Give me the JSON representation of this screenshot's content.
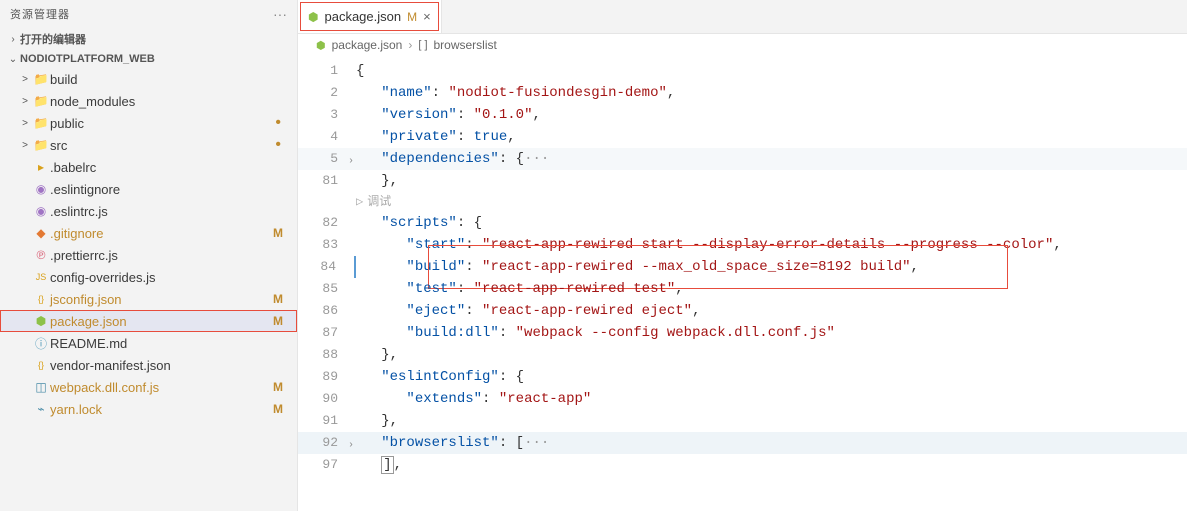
{
  "sidebar": {
    "title": "资源管理器",
    "open_editors": "打开的编辑器",
    "project": "NODIOTPLATFORM_WEB",
    "tree": [
      {
        "type": "folder",
        "label": "build",
        "icon": "folder",
        "indent": 1,
        "chev": ">"
      },
      {
        "type": "folder",
        "label": "node_modules",
        "icon": "folder-green",
        "indent": 1,
        "chev": ">"
      },
      {
        "type": "folder",
        "label": "public",
        "icon": "folder",
        "indent": 1,
        "chev": ">",
        "dot": true
      },
      {
        "type": "folder",
        "label": "src",
        "icon": "folder",
        "indent": 1,
        "chev": ">",
        "dot": true
      },
      {
        "type": "file",
        "label": ".babelrc",
        "icon": "babel",
        "indent": 1,
        "color": "file-yellow"
      },
      {
        "type": "file",
        "label": ".eslintignore",
        "icon": "eslint",
        "indent": 1,
        "color": "file-purple"
      },
      {
        "type": "file",
        "label": ".eslintrc.js",
        "icon": "eslint",
        "indent": 1,
        "color": "file-purple"
      },
      {
        "type": "file",
        "label": ".gitignore",
        "icon": "git",
        "indent": 1,
        "color": "file-orange",
        "badge": "M"
      },
      {
        "type": "file",
        "label": ".prettierrc.js",
        "icon": "prettier",
        "indent": 1,
        "color": "file-pink"
      },
      {
        "type": "file",
        "label": "config-overrides.js",
        "icon": "js",
        "indent": 1,
        "color": "file-yellow"
      },
      {
        "type": "file",
        "label": "jsconfig.json",
        "icon": "json",
        "indent": 1,
        "color": "file-yellow",
        "badge": "M"
      },
      {
        "type": "file",
        "label": "package.json",
        "icon": "npm",
        "indent": 1,
        "color": "file-green",
        "badge": "M",
        "selected": true,
        "highlighted": true
      },
      {
        "type": "file",
        "label": "README.md",
        "icon": "info",
        "indent": 1,
        "color": "file-teal"
      },
      {
        "type": "file",
        "label": "vendor-manifest.json",
        "icon": "json",
        "indent": 1,
        "color": "file-yellow"
      },
      {
        "type": "file",
        "label": "webpack.dll.conf.js",
        "icon": "webpack",
        "indent": 1,
        "color": "file-blue",
        "badge": "M"
      },
      {
        "type": "file",
        "label": "yarn.lock",
        "icon": "yarn",
        "indent": 1,
        "color": "file-blue",
        "badge": "M"
      }
    ]
  },
  "tab": {
    "title": "package.json",
    "mod": "M",
    "highlighted": true
  },
  "breadcrumbs": {
    "file": "package.json",
    "segment": "browserslist"
  },
  "debug_hint": "调试",
  "code": [
    {
      "n": 1,
      "t": [
        {
          "c": "bk",
          "v": "{"
        }
      ]
    },
    {
      "n": 2,
      "t": [
        {
          "c": "bk",
          "v": "   "
        },
        {
          "c": "bl",
          "v": "\"name\""
        },
        {
          "c": "bk",
          "v": ": "
        },
        {
          "c": "rd",
          "v": "\"nodiot-fusiondesgin-demo\""
        },
        {
          "c": "bk",
          "v": ","
        }
      ]
    },
    {
      "n": 3,
      "t": [
        {
          "c": "bk",
          "v": "   "
        },
        {
          "c": "bl",
          "v": "\"version\""
        },
        {
          "c": "bk",
          "v": ": "
        },
        {
          "c": "rd",
          "v": "\"0.1.0\""
        },
        {
          "c": "bk",
          "v": ","
        }
      ]
    },
    {
      "n": 4,
      "t": [
        {
          "c": "bk",
          "v": "   "
        },
        {
          "c": "bl",
          "v": "\"private\""
        },
        {
          "c": "bk",
          "v": ": "
        },
        {
          "c": "bl",
          "v": "true"
        },
        {
          "c": "bk",
          "v": ","
        }
      ]
    },
    {
      "n": 5,
      "fold": true,
      "shade": true,
      "t": [
        {
          "c": "bk",
          "v": "   "
        },
        {
          "c": "bl",
          "v": "\"dependencies\""
        },
        {
          "c": "bk",
          "v": ": {"
        },
        {
          "c": "gy",
          "v": "···"
        }
      ]
    },
    {
      "n": 81,
      "t": [
        {
          "c": "bk",
          "v": "   },"
        }
      ]
    },
    {
      "debug": true
    },
    {
      "n": 82,
      "t": [
        {
          "c": "bk",
          "v": "   "
        },
        {
          "c": "bl",
          "v": "\"scripts\""
        },
        {
          "c": "bk",
          "v": ": {"
        }
      ]
    },
    {
      "n": 83,
      "t": [
        {
          "c": "bk",
          "v": "      "
        },
        {
          "c": "bl",
          "v": "\"start\""
        },
        {
          "c": "bk",
          "v": ": "
        },
        {
          "c": "rd",
          "v": "\"react-app-rewired start --display-error-details --progress --color\""
        },
        {
          "c": "bk",
          "v": ","
        }
      ]
    },
    {
      "n": 84,
      "cursor": true,
      "hl": true,
      "t": [
        {
          "c": "bk",
          "v": "      "
        },
        {
          "c": "bl",
          "v": "\"build\""
        },
        {
          "c": "bk",
          "v": ": "
        },
        {
          "c": "rd",
          "v": "\"react-app-rewired --max_old_space_size=8192 build\""
        },
        {
          "c": "bk",
          "v": ","
        }
      ]
    },
    {
      "n": 85,
      "t": [
        {
          "c": "bk",
          "v": "      "
        },
        {
          "c": "bl",
          "v": "\"test\""
        },
        {
          "c": "bk",
          "v": ": "
        },
        {
          "c": "rd",
          "v": "\"react-app-rewired test\""
        },
        {
          "c": "bk",
          "v": ","
        }
      ]
    },
    {
      "n": 86,
      "t": [
        {
          "c": "bk",
          "v": "      "
        },
        {
          "c": "bl",
          "v": "\"eject\""
        },
        {
          "c": "bk",
          "v": ": "
        },
        {
          "c": "rd",
          "v": "\"react-app-rewired eject\""
        },
        {
          "c": "bk",
          "v": ","
        }
      ]
    },
    {
      "n": 87,
      "t": [
        {
          "c": "bk",
          "v": "      "
        },
        {
          "c": "bl",
          "v": "\"build:dll\""
        },
        {
          "c": "bk",
          "v": ": "
        },
        {
          "c": "rd",
          "v": "\"webpack --config webpack.dll.conf.js\""
        }
      ]
    },
    {
      "n": 88,
      "t": [
        {
          "c": "bk",
          "v": "   },"
        }
      ]
    },
    {
      "n": 89,
      "t": [
        {
          "c": "bk",
          "v": "   "
        },
        {
          "c": "bl",
          "v": "\"eslintConfig\""
        },
        {
          "c": "bk",
          "v": ": {"
        }
      ]
    },
    {
      "n": 90,
      "t": [
        {
          "c": "bk",
          "v": "      "
        },
        {
          "c": "bl",
          "v": "\"extends\""
        },
        {
          "c": "bk",
          "v": ": "
        },
        {
          "c": "rd",
          "v": "\"react-app\""
        }
      ]
    },
    {
      "n": 91,
      "t": [
        {
          "c": "bk",
          "v": "   },"
        }
      ]
    },
    {
      "n": 92,
      "fold": true,
      "shade2": true,
      "t": [
        {
          "c": "bk",
          "v": "   "
        },
        {
          "c": "bl",
          "v": "\"browserslist\""
        },
        {
          "c": "bk",
          "v": ": ["
        },
        {
          "c": "gy",
          "v": "···"
        }
      ]
    },
    {
      "n": 97,
      "t": [
        {
          "c": "bk",
          "v": "   ],"
        }
      ],
      "bracket": true
    }
  ]
}
